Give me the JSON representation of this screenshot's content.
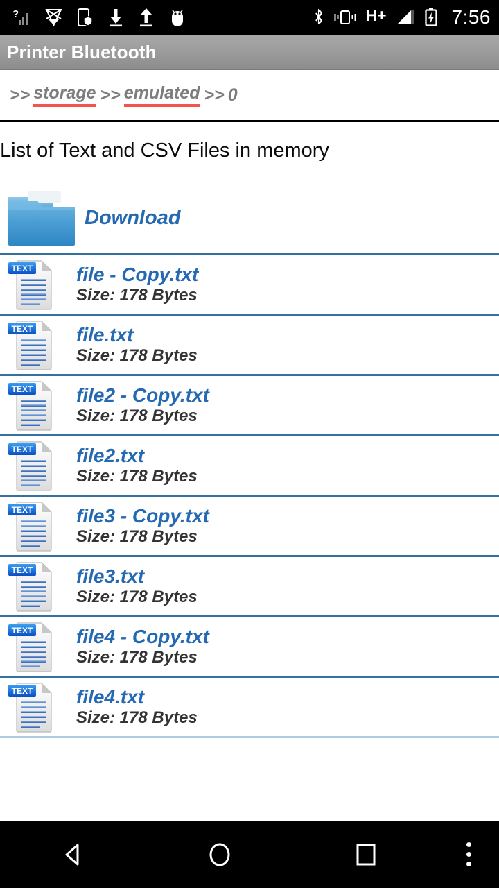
{
  "statusbar": {
    "time": "7:56",
    "network_type": "H+",
    "left_icons": [
      {
        "name": "signal-unknown-icon"
      },
      {
        "name": "no-sim-icon"
      },
      {
        "name": "phone-shield-icon"
      },
      {
        "name": "download-icon"
      },
      {
        "name": "upload-icon"
      },
      {
        "name": "android-debug-icon"
      }
    ],
    "right_icons": [
      {
        "name": "bluetooth-icon"
      },
      {
        "name": "vibrate-icon"
      },
      {
        "name": "signal-bars-icon"
      },
      {
        "name": "battery-charging-icon"
      }
    ]
  },
  "actionbar": {
    "title": "Printer Bluetooth"
  },
  "breadcrumb": {
    "segments": [
      {
        "prefix": ">>",
        "label": "storage",
        "link": true
      },
      {
        "prefix": ">>",
        "label": "emulated",
        "link": true
      },
      {
        "prefix": ">>",
        "label": "0",
        "link": false
      }
    ]
  },
  "main": {
    "heading": "List of Text and CSV Files in memory",
    "items": [
      {
        "type": "folder",
        "name": "Download",
        "icon": "folder-icon"
      },
      {
        "type": "file",
        "name": "file - Copy.txt",
        "size": "Size: 178 Bytes",
        "icon": "text-file-icon"
      },
      {
        "type": "file",
        "name": "file.txt",
        "size": "Size: 178 Bytes",
        "icon": "text-file-icon"
      },
      {
        "type": "file",
        "name": "file2 - Copy.txt",
        "size": "Size: 178 Bytes",
        "icon": "text-file-icon"
      },
      {
        "type": "file",
        "name": "file2.txt",
        "size": "Size: 178 Bytes",
        "icon": "text-file-icon"
      },
      {
        "type": "file",
        "name": "file3 - Copy.txt",
        "size": "Size: 178 Bytes",
        "icon": "text-file-icon"
      },
      {
        "type": "file",
        "name": "file3.txt",
        "size": "Size: 178 Bytes",
        "icon": "text-file-icon"
      },
      {
        "type": "file",
        "name": "file4 - Copy.txt",
        "size": "Size: 178 Bytes",
        "icon": "text-file-icon"
      },
      {
        "type": "file",
        "name": "file4.txt",
        "size": "Size: 178 Bytes",
        "icon": "text-file-icon"
      }
    ]
  },
  "navbar": {
    "buttons": [
      {
        "name": "back-button"
      },
      {
        "name": "home-button"
      },
      {
        "name": "recents-button"
      },
      {
        "name": "overflow-menu-button"
      }
    ]
  },
  "colors": {
    "accent_blue": "#2569b2",
    "separator_blue": "#35719e",
    "separator_blue_light": "#a9cde2",
    "breadcrumb_gray": "#7d7d7d",
    "breadcrumb_underline_red": "#f4544c",
    "actionbar_gray": "#9a9a9a",
    "statusbar_black": "#000000"
  }
}
